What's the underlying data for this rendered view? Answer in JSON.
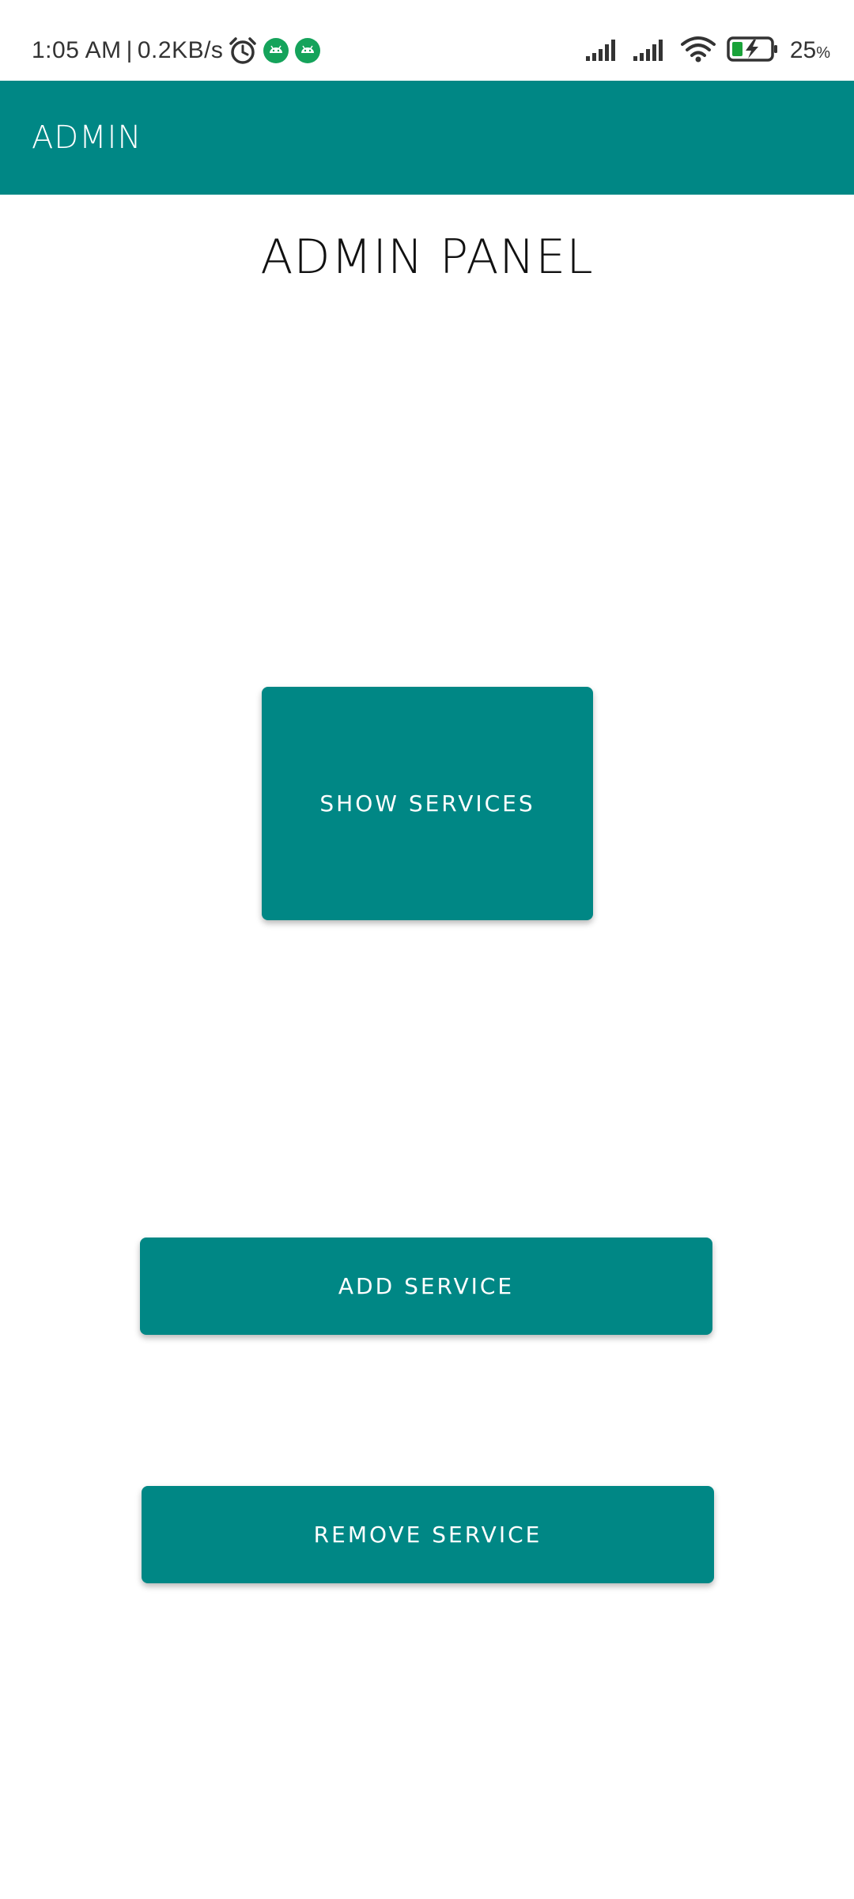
{
  "status_bar": {
    "time": "1:05 AM",
    "separator": "|",
    "net_speed": "0.2KB/s",
    "battery_percent": "25",
    "battery_symbol": "%",
    "icons": [
      "alarm-icon",
      "android-notification-icon",
      "android-notification-icon",
      "signal-icon",
      "signal-icon",
      "wifi-icon",
      "battery-charging-icon"
    ],
    "battery_color": "#1aa33a"
  },
  "app_bar": {
    "title": "ADMIN",
    "color": "#008785"
  },
  "page": {
    "title": "ADMIN PANEL"
  },
  "buttons": {
    "show_services": "SHOW SERVICES",
    "add_service": "ADD SERVICE",
    "remove_service": "REMOVE SERVICE",
    "color": "#008785"
  }
}
